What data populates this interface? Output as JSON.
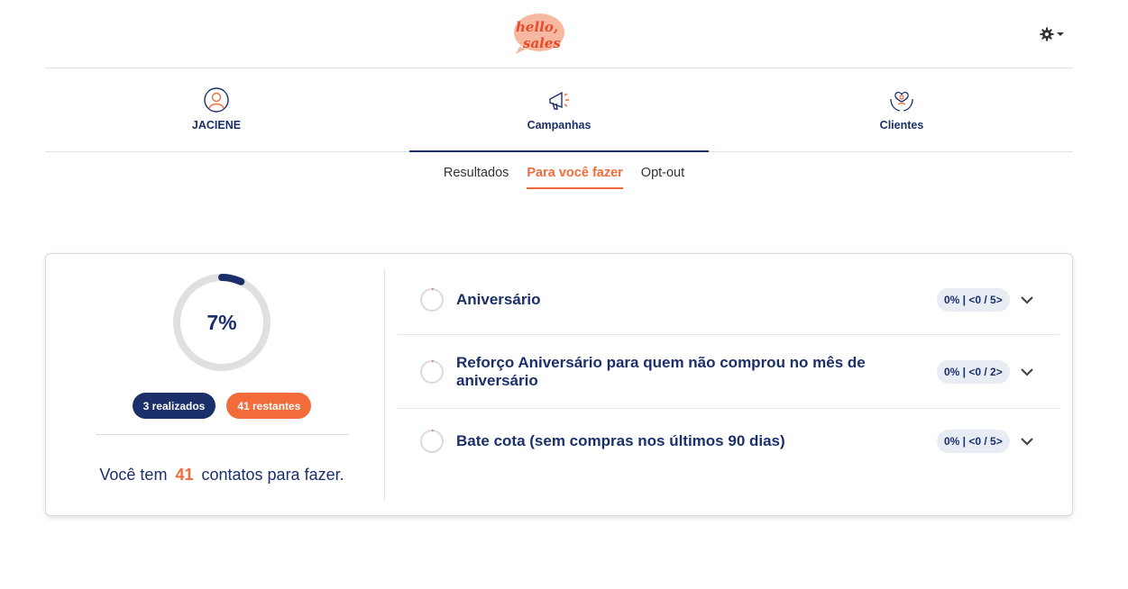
{
  "brand": {
    "logo_alt": "hello sales"
  },
  "colors": {
    "primary": "#1b2f6b",
    "accent": "#f26b3a",
    "ring_track": "#e0e0e0"
  },
  "header": {
    "settings_icon": "gear-icon"
  },
  "main_nav": [
    {
      "label": "JACIENE",
      "icon": "user-icon",
      "active": false
    },
    {
      "label": "Campanhas",
      "icon": "megaphone-icon",
      "active": true
    },
    {
      "label": "Clientes",
      "icon": "heart-hands-icon",
      "active": false
    }
  ],
  "sub_tabs": [
    {
      "label": "Resultados",
      "active": false
    },
    {
      "label": "Para você fazer",
      "active": true
    },
    {
      "label": "Opt-out",
      "active": false
    }
  ],
  "progress": {
    "percent_label": "7%",
    "fraction": 0.07,
    "done_label": "3 realizados",
    "remaining_label": "41 restantes",
    "summary_prefix": "Você tem",
    "summary_count": "41",
    "summary_suffix": "contatos para fazer."
  },
  "campaigns": [
    {
      "title": "Aniversário",
      "badge": "0% | <0 / 5>"
    },
    {
      "title": "Reforço Aniversário para quem não comprou no mês de aniversário",
      "badge": "0% | <0 / 2>"
    },
    {
      "title": "Bate cota (sem compras nos últimos 90 dias)",
      "badge": "0% | <0 / 5>"
    }
  ]
}
